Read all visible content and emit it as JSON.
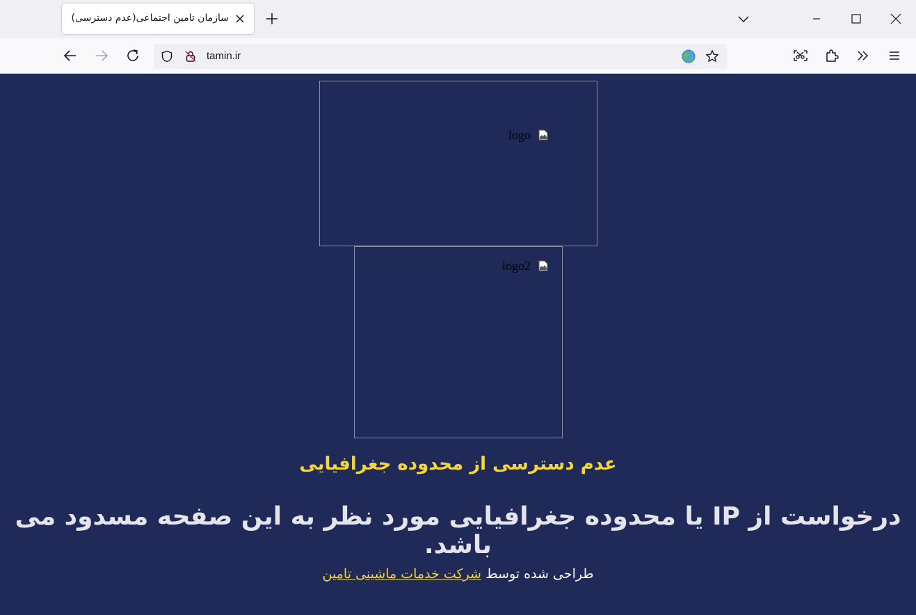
{
  "browser": {
    "tab": {
      "title": "سازمان تامین اجتماعی(عدم دسترسی)"
    },
    "url": "tamin.ir",
    "icons": {
      "close_tab": "close-icon",
      "new_tab": "plus-icon",
      "tab_list": "chevron-down-icon",
      "back": "arrow-left-icon",
      "forward": "arrow-right-icon",
      "reload": "reload-icon",
      "shield": "shield-icon",
      "insecure": "insecure-lock-icon",
      "translate": "globe-icon",
      "bookmark": "star-icon",
      "extensions": "puzzle-icon",
      "overflow": "chevrons-right-icon",
      "menu": "hamburger-icon"
    }
  },
  "page": {
    "logo_alt": "logo",
    "logo2_alt": "logo2",
    "heading": "عدم دسترسی از محدوده جغرافیایی",
    "message": "درخواست از IP یا محدوده جغرافیایی مورد نظر به این صفحه مسدود می باشد.",
    "footer": {
      "prefix": "طراحی شده توسط",
      "link_text": "شرکت خدمات ماشینی تامین"
    },
    "colors": {
      "background": "#1f2a58",
      "heading": "#f4d53a",
      "message": "#e4e4ea",
      "link": "#f4d53a"
    }
  }
}
